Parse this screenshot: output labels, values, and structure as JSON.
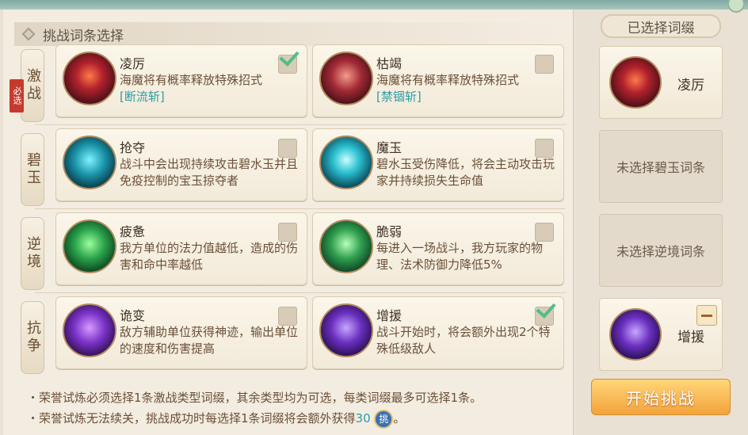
{
  "header": {
    "title": "挑战词条选择"
  },
  "rows": [
    {
      "label": "激战",
      "required_tag": "必选",
      "cards": [
        {
          "name": "凌厉",
          "desc": "海魔将有概率释放特殊招式",
          "tag": "[断流斩]",
          "checked": true,
          "icon": "crimson-beast-icon"
        },
        {
          "name": "枯竭",
          "desc": "海魔将有概率释放特殊招式",
          "tag": "[禁锢斩]",
          "checked": false,
          "icon": "crimson-claw-icon"
        }
      ]
    },
    {
      "label": "碧玉",
      "cards": [
        {
          "name": "抢夺",
          "desc": "战斗中会出现持续攻击碧水玉并且免疫控制的宝玉掠夺者",
          "checked": false,
          "icon": "jade-thief-icon"
        },
        {
          "name": "魔玉",
          "desc": "碧水玉受伤降低，将会主动攻击玩家并持续损失生命值",
          "checked": false,
          "icon": "jade-orb-icon"
        }
      ]
    },
    {
      "label": "逆境",
      "cards": [
        {
          "name": "疲惫",
          "desc": "我方单位的法力值越低，造成的伤害和命中率越低",
          "checked": false,
          "icon": "weary-figure-icon"
        },
        {
          "name": "脆弱",
          "desc": "每进入一场战斗，我方玩家的物理、法术防御力降低5%",
          "checked": false,
          "icon": "fragile-figure-icon"
        }
      ]
    },
    {
      "label": "抗争",
      "cards": [
        {
          "name": "诡变",
          "desc": "敌方辅助单位获得神迹，输出单位的速度和伤害提高",
          "checked": false,
          "icon": "purple-vortex-icon"
        },
        {
          "name": "增援",
          "desc": "战斗开始时，将会额外出现2个特殊低级敌人",
          "checked": true,
          "icon": "purple-crystal-icon"
        }
      ]
    }
  ],
  "notes": {
    "line1": "・荣誉试炼必须选择1条激战类型词缀，其余类型均为可选，每类词缀最多可选择1条。",
    "line2_prefix": "・荣誉试炼无法续关，挑战成功时每选择1条词缀将会额外获得",
    "line2_value": "30",
    "coin_glyph": "挑",
    "line2_suffix": "。"
  },
  "side": {
    "title": "已选择词缀",
    "slots": [
      {
        "filled": true,
        "name": "凌厉"
      },
      {
        "filled": false,
        "text": "未选择碧玉词条"
      },
      {
        "filled": false,
        "text": "未选择逆境词条"
      },
      {
        "filled": true,
        "name": "增援"
      }
    ],
    "start_button": "开始挑战"
  },
  "colors": {
    "accent_teal": "#2a9da6",
    "check_green": "#4fbf86",
    "required_red": "#c63a2e",
    "start_orange": "#f3a33b"
  }
}
